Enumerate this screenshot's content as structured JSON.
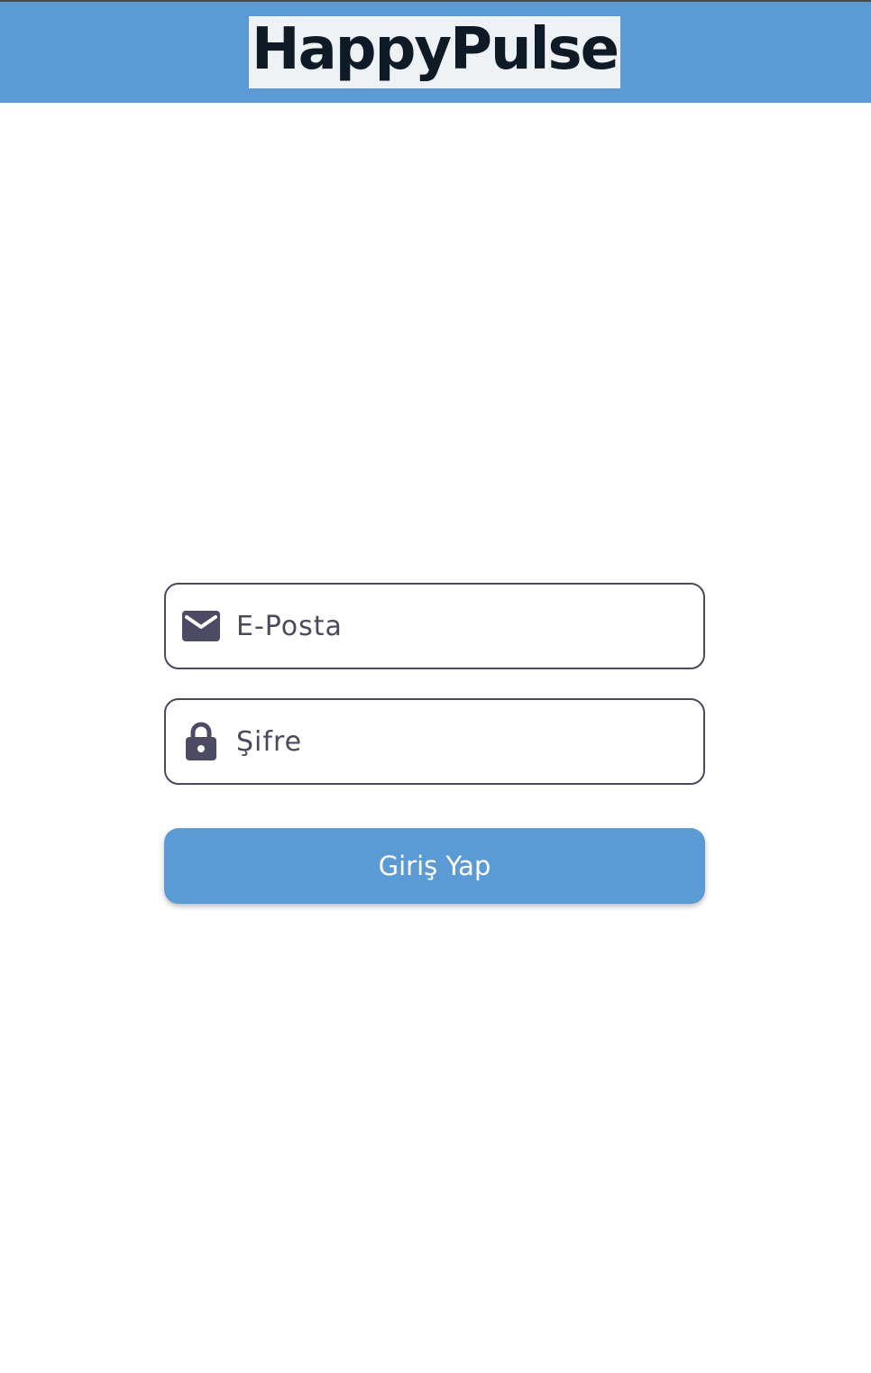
{
  "header": {
    "logo_text": "HappyPulse",
    "background_color": "#5b9bd5"
  },
  "login_form": {
    "email": {
      "icon": "mail-icon",
      "placeholder": "E-Posta",
      "value": ""
    },
    "password": {
      "icon": "lock-icon",
      "placeholder": "Şifre",
      "value": ""
    },
    "submit_label": "Giriş Yap",
    "button_color": "#5b9bd5"
  }
}
